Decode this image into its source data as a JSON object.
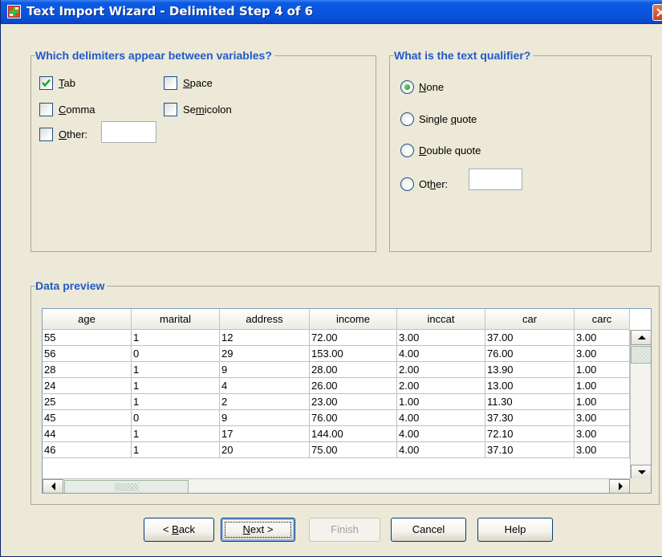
{
  "window": {
    "title": "Text Import Wizard - Delimited Step 4 of 6"
  },
  "delimiters": {
    "title": "Which delimiters appear between variables?",
    "options": [
      {
        "pre": "",
        "key": "T",
        "post": "ab",
        "checked": true
      },
      {
        "pre": "",
        "key": "S",
        "post": "pace",
        "checked": false
      },
      {
        "pre": "",
        "key": "C",
        "post": "omma",
        "checked": false
      },
      {
        "pre": "Se",
        "key": "m",
        "post": "icolon",
        "checked": false
      },
      {
        "pre": "",
        "key": "O",
        "post": "ther:",
        "checked": false
      }
    ],
    "other_value": ""
  },
  "qualifier": {
    "title": "What is the text qualifier?",
    "options": [
      {
        "pre": "",
        "key": "N",
        "post": "one",
        "selected": true
      },
      {
        "pre": "Single ",
        "key": "q",
        "post": "uote",
        "selected": false
      },
      {
        "pre": "",
        "key": "D",
        "post": "ouble quote",
        "selected": false
      },
      {
        "pre": "Ot",
        "key": "h",
        "post": "er:",
        "selected": false
      }
    ],
    "other_value": ""
  },
  "preview": {
    "title": "Data preview",
    "columns": [
      "age",
      "marital",
      "address",
      "income",
      "inccat",
      "car",
      "carc"
    ],
    "rows": [
      [
        "55",
        "1",
        "12",
        "72.00",
        "3.00",
        "37.00",
        "3.00"
      ],
      [
        "56",
        "0",
        "29",
        "153.00",
        "4.00",
        "76.00",
        "3.00"
      ],
      [
        "28",
        "1",
        "9",
        "28.00",
        "2.00",
        "13.90",
        "1.00"
      ],
      [
        "24",
        "1",
        "4",
        "26.00",
        "2.00",
        "13.00",
        "1.00"
      ],
      [
        "25",
        "1",
        "2",
        "23.00",
        "1.00",
        "11.30",
        "1.00"
      ],
      [
        "45",
        "0",
        "9",
        "76.00",
        "4.00",
        "37.30",
        "3.00"
      ],
      [
        "44",
        "1",
        "17",
        "144.00",
        "4.00",
        "72.10",
        "3.00"
      ],
      [
        "46",
        "1",
        "20",
        "75.00",
        "4.00",
        "37.10",
        "3.00"
      ]
    ]
  },
  "buttons": {
    "back": {
      "pre": "< ",
      "key": "B",
      "post": "ack"
    },
    "next": {
      "pre": "",
      "key": "N",
      "post": "ext >"
    },
    "finish": "Finish",
    "cancel": "Cancel",
    "help": "Help"
  },
  "colors": {
    "titlebar": "#0a52db",
    "group_title": "#2359c8",
    "dialog_bg": "#ece9d8",
    "check": "#21a121"
  }
}
